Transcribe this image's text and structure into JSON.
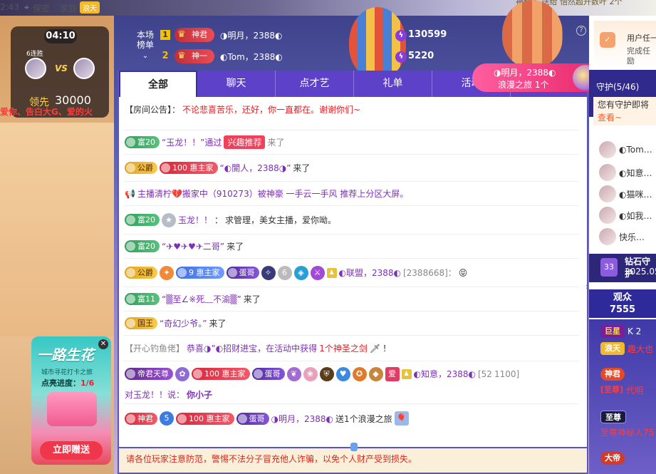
{
  "topbar": {
    "time": "2:43",
    "status1": "保密",
    "family": "家族",
    "family_tag": "浪天",
    "right_text": "神秘人 送给 悟然超升数叶 2个"
  },
  "pk": {
    "timer": "04:10",
    "streak": "6连胜",
    "vs": "VS",
    "lead_label": "领先",
    "lead_score": "30000",
    "ticker": "爱你、告白大G、爱的火"
  },
  "promo": {
    "title": "一路生花",
    "subtitle": "城市寻花打卡之旅",
    "progress_label": "点亮进度：",
    "progress_value": "1/6",
    "button": "立即赠送",
    "close": "✕"
  },
  "rank": {
    "label_line1": "本场",
    "label_line2": "榜单",
    "rows": [
      {
        "no": "1",
        "badge": "神君",
        "name": "◑明月，2388◐",
        "value": "130599"
      },
      {
        "no": "2",
        "badge": "神一",
        "name": "◐Tom，2388◐",
        "value": "5220"
      }
    ]
  },
  "tabs": [
    "全部",
    "聊天",
    "点才艺",
    "礼单",
    "活动"
  ],
  "toast": {
    "name": "◑明月，2388◐",
    "gift": "浪漫之旅 1个"
  },
  "chat": {
    "announce_prefix": "【房间公告】：",
    "announce": "不论悲喜苦乐，还好，你一直都在。谢谢你们~",
    "l1": {
      "badge": "富20",
      "q": "“玉龙！！”通过",
      "tag": "兴趣推荐",
      "tail": "来了"
    },
    "l2": {
      "badge": "公爵",
      "badge2": "100",
      "badge3": "惠主家",
      "name": "“◐閬人，2388◑”",
      "tail": "来了"
    },
    "l3": {
      "text": "主播清柠💔搬家中（910273）被神豪 一手云一手风 推荐上分区大屏。"
    },
    "l4": {
      "badge": "富20",
      "name": "玉龙！！",
      "sep": "：",
      "text": "求管理，美女主播，爱你呦。"
    },
    "l5": {
      "badge": "富20",
      "name": "“✈♥✈♥✈二哥”",
      "tail": "来了"
    },
    "l6": {
      "badge": "公爵",
      "badge2": "9",
      "badge3": "惠主家",
      "badge4": "蛋哥",
      "name": "◐联盟，2388◐",
      "id": "[2388668]：",
      "emoji": "😝"
    },
    "l7": {
      "badge": "富11",
      "name": "“▒至∠※死﹏不渝▒”",
      "tail": "来了"
    },
    "l8": {
      "badge": "国王",
      "name": "“奇幻少爷。”",
      "tail": "来了"
    },
    "l9": {
      "prefix": "【开心钓鱼佬】",
      "text": "恭喜◑”◐招财进宝，在活动中获得",
      "count": "1个神圣之剑",
      "tail": "！"
    },
    "l10": {
      "badge": "帝君天尊",
      "badge2": "100",
      "badge3": "惠主家",
      "badge4": "蛋哥",
      "name": "◐知意，2388◐",
      "id": "[52",
      "id2": "1100]",
      "mid": "对玉龙！！说：",
      "say": "你小子"
    },
    "l11": {
      "badge": "神君",
      "badge2": "5",
      "badge3": "100",
      "badge4": "惠主家",
      "badge5": "蛋哥",
      "name": "◑明月，2388◐",
      "text": "送1个浪漫之旅"
    },
    "warn": "请各位玩家注意防范，警惕不法分子冒充他人诈骗，以免个人财产受到损失。"
  },
  "right": {
    "mission_a": "用户任一",
    "mission_b": "完成任",
    "mission_c": "励",
    "guard_title": "守护(5/46)",
    "guard_tip1": "您有守护即将",
    "guard_tip2": "查看~",
    "guards": [
      "◐Tom…",
      "◐知意…",
      "◐猫咪…",
      "◐如我…",
      "快乐…"
    ],
    "diamond_a": "钻石守护",
    "diamond_b": "2025.05",
    "diamond_badge": "33",
    "aud_label": "观众",
    "aud_count": "7555",
    "aud": [
      {
        "badge": "巨星",
        "extra": "K 2"
      },
      {
        "badge": "浪天",
        "extra": "趣大也"
      },
      {
        "badge": "神君",
        "extra": ""
      },
      {
        "badge": "[至尊]",
        "extra": "代明"
      },
      {
        "badge": "至尊",
        "extra": ""
      },
      {
        "badge": "至尊神秘人75",
        "extra": ""
      },
      {
        "badge": "大帝",
        "extra": ""
      }
    ]
  },
  "colors": {
    "accent": "#5e41c9",
    "warn": "#d3271e",
    "tab_bar": "#5e41c9"
  }
}
